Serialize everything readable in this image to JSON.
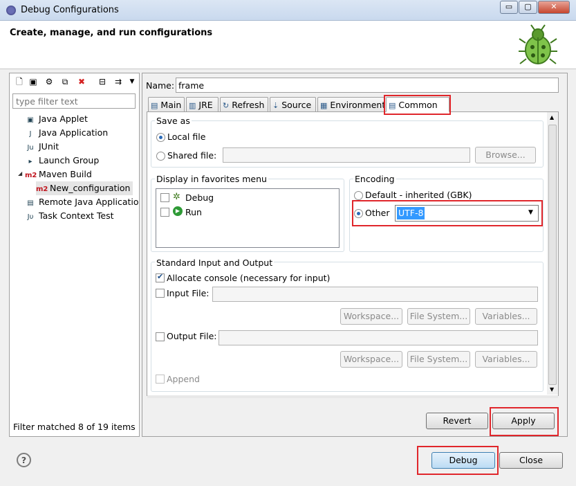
{
  "window": {
    "title": "Debug Configurations",
    "minimize": "▭",
    "maximize": "▢",
    "close": "✕"
  },
  "header": {
    "heading": "Create, manage, and run configurations"
  },
  "sidebar": {
    "filter_placeholder": "type filter text",
    "items": [
      {
        "label": "Java Applet",
        "icon": "java-applet-icon",
        "glyph": "▣"
      },
      {
        "label": "Java Application",
        "icon": "java-application-icon",
        "glyph": "J"
      },
      {
        "label": "JUnit",
        "icon": "junit-icon",
        "glyph": "Ju"
      },
      {
        "label": "Launch Group",
        "icon": "launch-group-icon",
        "glyph": "▸"
      },
      {
        "label": "Maven Build",
        "icon": "maven-icon",
        "glyph": "m2"
      },
      {
        "label": "New_configuration",
        "icon": "maven-icon",
        "glyph": "m2"
      },
      {
        "label": "Remote Java Applicatio",
        "icon": "remote-java-icon",
        "glyph": "▤"
      },
      {
        "label": "Task Context Test",
        "icon": "task-context-icon",
        "glyph": "Jυ"
      }
    ],
    "status": "Filter matched 8 of 19 items"
  },
  "config": {
    "name_label": "Name:",
    "name_value": "frame",
    "tabs": [
      {
        "label": "Main",
        "icon": "main-tab-icon",
        "glyph": "▤"
      },
      {
        "label": "JRE",
        "icon": "jre-tab-icon",
        "glyph": "▥"
      },
      {
        "label": "Refresh",
        "icon": "refresh-tab-icon",
        "glyph": "↻"
      },
      {
        "label": "Source",
        "icon": "source-tab-icon",
        "glyph": "⇣"
      },
      {
        "label": "Environment",
        "icon": "environment-tab-icon",
        "glyph": "▦"
      },
      {
        "label": "Common",
        "icon": "common-tab-icon",
        "glyph": "▤"
      }
    ],
    "save_as": {
      "title": "Save as",
      "local_file": "Local file",
      "shared_file": "Shared file:",
      "browse": "Browse..."
    },
    "favorites": {
      "title": "Display in favorites menu",
      "items": [
        {
          "label": "Debug",
          "icon": "debug-bug-icon"
        },
        {
          "label": "Run",
          "icon": "run-icon"
        }
      ]
    },
    "encoding": {
      "title": "Encoding",
      "default": "Default - inherited (GBK)",
      "other": "Other",
      "other_value": "UTF-8"
    },
    "stdio": {
      "title": "Standard Input and Output",
      "allocate": "Allocate console (necessary for input)",
      "input_file": "Input File:",
      "output_file": "Output File:",
      "workspace": "Workspace...",
      "file_system": "File System...",
      "variables": "Variables...",
      "append": "Append"
    },
    "revert": "Revert",
    "apply": "Apply"
  },
  "footer": {
    "help": "?",
    "debug": "Debug",
    "close": "Close"
  },
  "colors": {
    "highlight_red": "#e0262b",
    "selection_blue": "#3399ff"
  }
}
